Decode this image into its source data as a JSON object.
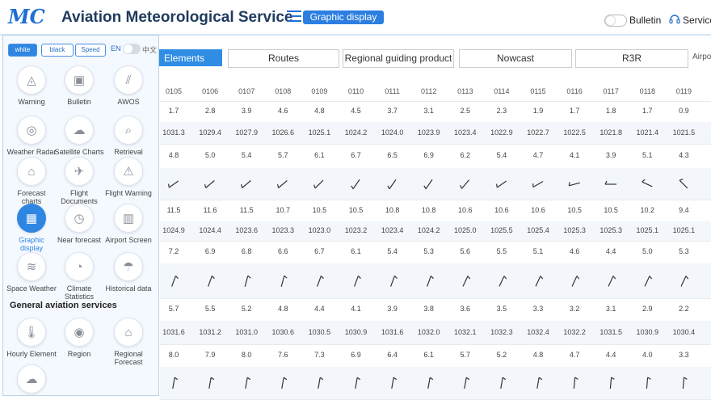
{
  "header": {
    "logo_text": "MC",
    "title": "Aviation Meteorological Service",
    "graphic_display_label": "Graphic display",
    "bulletin_label": "Bulletin",
    "service_label": "Service",
    "bulletin_toggle_on": false
  },
  "tabs": [
    "Elements",
    "Routes",
    "Regional guiding product",
    "Nowcast",
    "R3R",
    "Airpo"
  ],
  "panel": {
    "themes": [
      "white",
      "black",
      "Speed"
    ],
    "active_theme": "white",
    "lang_en": "EN",
    "lang_zh": "中文",
    "items": [
      {
        "label": "Warning",
        "icon": "warning-icon"
      },
      {
        "label": "Bulletin",
        "icon": "bulletin-icon"
      },
      {
        "label": "AWOS",
        "icon": "awos-icon"
      },
      {
        "label": "Weather Radar",
        "icon": "radar-icon"
      },
      {
        "label": "Satellite Charts",
        "icon": "cloud-icon"
      },
      {
        "label": "Retrieval",
        "icon": "search-icon"
      },
      {
        "label": "Forecast charts",
        "icon": "house-icon"
      },
      {
        "label": "Flight Documents",
        "icon": "plane-icon"
      },
      {
        "label": "Flight Warning",
        "icon": "flight-warning-icon"
      },
      {
        "label": "Graphic display",
        "icon": "graphic-display-icon",
        "active": true
      },
      {
        "label": "Near forecast",
        "icon": "clock-icon"
      },
      {
        "label": "Airport Screen",
        "icon": "airport-screen-icon"
      },
      {
        "label": "Space Weather",
        "icon": "space-weather-icon"
      },
      {
        "label": "Climate Statistics",
        "icon": "pie-chart-icon"
      },
      {
        "label": "Historical data",
        "icon": "historical-data-icon"
      }
    ],
    "general_title": "General aviation services",
    "general_items": [
      {
        "label": "Hourly Element",
        "icon": "thermometer-icon"
      },
      {
        "label": "Region",
        "icon": "region-icon"
      },
      {
        "label": "Regional Forecast",
        "icon": "regional-forecast-icon"
      },
      {
        "label": "",
        "icon": "cloud-icon"
      }
    ]
  },
  "table": {
    "hours": [
      "0105",
      "0106",
      "0107",
      "0108",
      "0109",
      "0110",
      "0111",
      "0112",
      "0113",
      "0114",
      "0115",
      "0116",
      "0117",
      "0118",
      "0119"
    ],
    "rows": [
      {
        "type": "num",
        "values": [
          "1.7",
          "2.8",
          "3.9",
          "4.6",
          "4.8",
          "4.5",
          "3.7",
          "3.1",
          "2.5",
          "2.3",
          "1.9",
          "1.7",
          "1.8",
          "1.7",
          "0.9"
        ]
      },
      {
        "type": "num",
        "values": [
          "1031.3",
          "1029.4",
          "1027.9",
          "1026.6",
          "1025.1",
          "1024.2",
          "1024.0",
          "1023.9",
          "1023.4",
          "1022.9",
          "1022.7",
          "1022.5",
          "1021.8",
          "1021.4",
          "1021.5"
        ]
      },
      {
        "type": "num",
        "values": [
          "4.8",
          "5.0",
          "5.4",
          "5.7",
          "6.1",
          "6.7",
          "6.5",
          "6.9",
          "6.2",
          "5.4",
          "4.7",
          "4.1",
          "3.9",
          "5.1",
          "4.3"
        ]
      },
      {
        "type": "wind",
        "values": [
          235,
          230,
          230,
          230,
          225,
          215,
          215,
          215,
          220,
          235,
          240,
          255,
          270,
          295,
          315
        ]
      },
      {
        "type": "num",
        "values": [
          "11.5",
          "11.6",
          "11.5",
          "10.7",
          "10.5",
          "10.5",
          "10.8",
          "10.8",
          "10.6",
          "10.6",
          "10.6",
          "10.5",
          "10.5",
          "10.2",
          "9.4"
        ]
      },
      {
        "type": "num",
        "values": [
          "1024.9",
          "1024.4",
          "1023.6",
          "1023.3",
          "1023.0",
          "1023.2",
          "1023.4",
          "1024.2",
          "1025.0",
          "1025.5",
          "1025.4",
          "1025.3",
          "1025.3",
          "1025.1",
          "1025.1"
        ]
      },
      {
        "type": "num",
        "values": [
          "7.2",
          "6.9",
          "6.8",
          "6.6",
          "6.7",
          "6.1",
          "5.4",
          "5.3",
          "5.6",
          "5.5",
          "5.1",
          "4.6",
          "4.4",
          "5.0",
          "5.3"
        ]
      },
      {
        "type": "wind",
        "values": [
          20,
          20,
          15,
          15,
          20,
          20,
          20,
          20,
          25,
          25,
          25,
          25,
          25,
          25,
          25
        ]
      },
      {
        "type": "num",
        "values": [
          "5.7",
          "5.5",
          "5.2",
          "4.8",
          "4.4",
          "4.1",
          "3.9",
          "3.8",
          "3.6",
          "3.5",
          "3.3",
          "3.2",
          "3.1",
          "2.9",
          "2.2"
        ]
      },
      {
        "type": "num",
        "values": [
          "1031.6",
          "1031.2",
          "1031.0",
          "1030.6",
          "1030.5",
          "1030.9",
          "1031.6",
          "1032.0",
          "1032.1",
          "1032.3",
          "1032.4",
          "1032.2",
          "1031.5",
          "1030.9",
          "1030.4"
        ]
      },
      {
        "type": "num",
        "values": [
          "8.0",
          "7.9",
          "8.0",
          "7.6",
          "7.3",
          "6.9",
          "6.4",
          "6.1",
          "5.7",
          "5.2",
          "4.8",
          "4.7",
          "4.4",
          "4.0",
          "3.3"
        ]
      },
      {
        "type": "wind",
        "values": [
          10,
          10,
          10,
          10,
          10,
          10,
          10,
          10,
          10,
          10,
          10,
          5,
          5,
          5,
          5
        ]
      }
    ]
  }
}
